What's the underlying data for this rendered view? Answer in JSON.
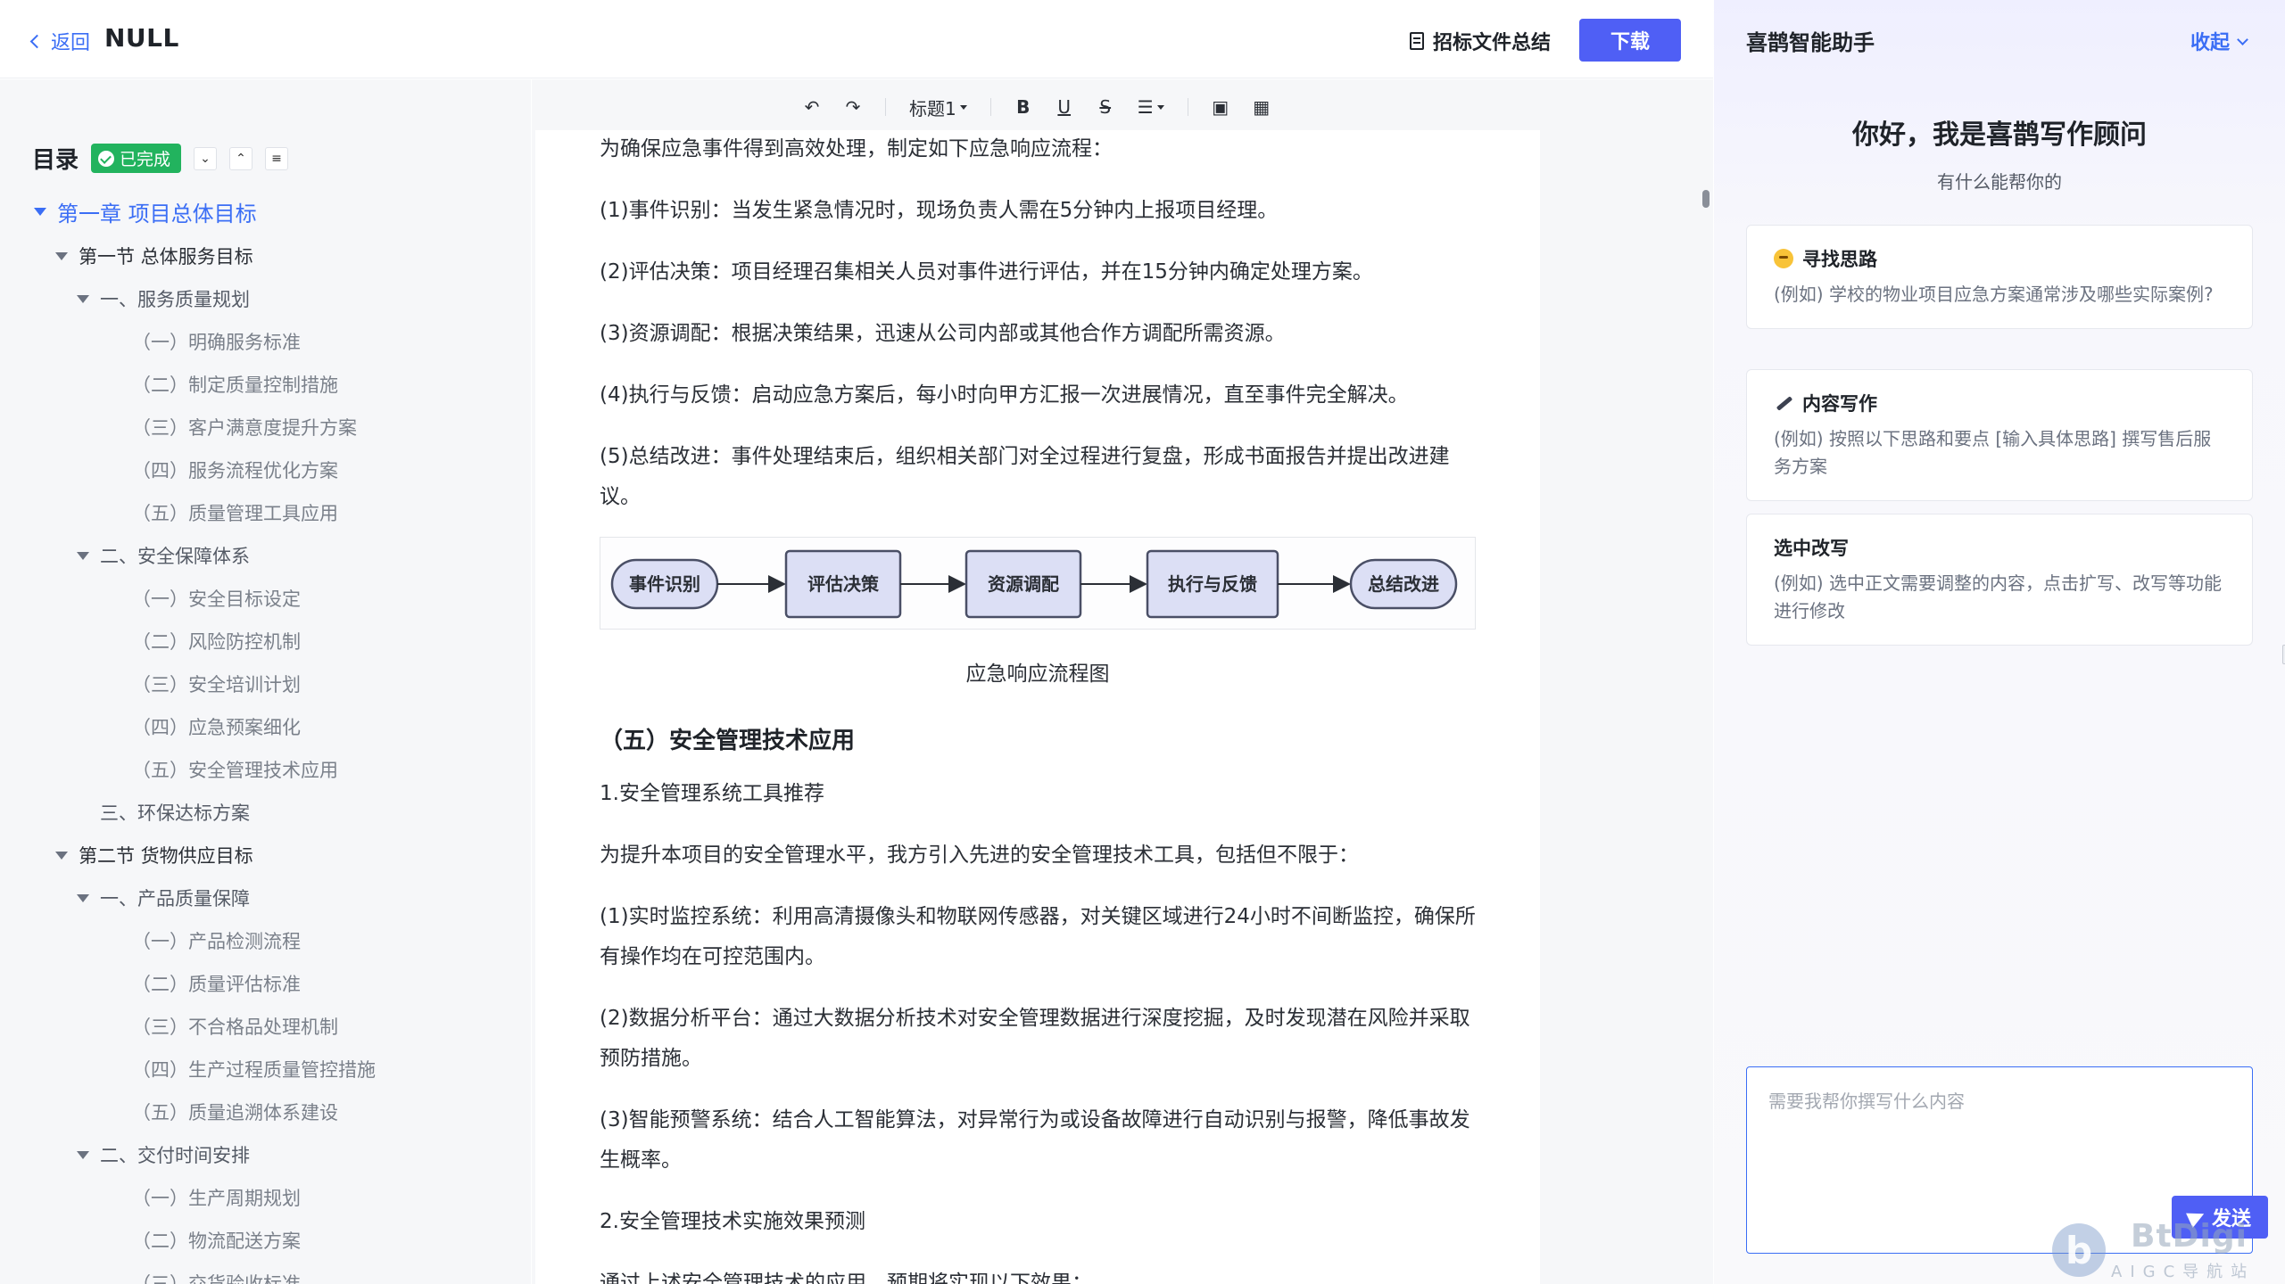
{
  "header": {
    "back_label": "返回",
    "doc_title": "NULL",
    "summary_label": "招标文件总结",
    "download_label": "下载"
  },
  "toc": {
    "title": "目录",
    "status_badge": "已完成",
    "items": [
      {
        "level": 1,
        "label": "第一章 项目总体目标",
        "expanded": true
      },
      {
        "level": 2,
        "label": "第一节 总体服务目标",
        "expanded": true
      },
      {
        "level": 3,
        "label": "一、服务质量规划",
        "expanded": true
      },
      {
        "level": 4,
        "label": "（一）明确服务标准"
      },
      {
        "level": 4,
        "label": "（二）制定质量控制措施"
      },
      {
        "level": 4,
        "label": "（三）客户满意度提升方案"
      },
      {
        "level": 4,
        "label": "（四）服务流程优化方案"
      },
      {
        "level": 4,
        "label": "（五）质量管理工具应用"
      },
      {
        "level": 3,
        "label": "二、安全保障体系",
        "expanded": true
      },
      {
        "level": 4,
        "label": "（一）安全目标设定"
      },
      {
        "level": 4,
        "label": "（二）风险防控机制"
      },
      {
        "level": 4,
        "label": "（三）安全培训计划"
      },
      {
        "level": 4,
        "label": "（四）应急预案细化"
      },
      {
        "level": 4,
        "label": "（五）安全管理技术应用"
      },
      {
        "level": 3,
        "label": "三、环保达标方案",
        "expanded": false
      },
      {
        "level": 2,
        "label": "第二节 货物供应目标",
        "expanded": true
      },
      {
        "level": 3,
        "label": "一、产品质量保障",
        "expanded": true
      },
      {
        "level": 4,
        "label": "（一）产品检测流程"
      },
      {
        "level": 4,
        "label": "（二）质量评估标准"
      },
      {
        "level": 4,
        "label": "（三）不合格品处理机制"
      },
      {
        "level": 4,
        "label": "（四）生产过程质量管控措施"
      },
      {
        "level": 4,
        "label": "（五）质量追溯体系建设"
      },
      {
        "level": 3,
        "label": "二、交付时间安排",
        "expanded": true
      },
      {
        "level": 4,
        "label": "（一）生产周期规划"
      },
      {
        "level": 4,
        "label": "（二）物流配送方案"
      },
      {
        "level": 4,
        "label": "（三）交货验收标准"
      }
    ]
  },
  "toolbar": {
    "heading_select": "标题1"
  },
  "document": {
    "intro": "为确保应急事件得到高效处理，制定如下应急响应流程：",
    "steps": [
      "(1)事件识别：当发生紧急情况时，现场负责人需在5分钟内上报项目经理。",
      "(2)评估决策：项目经理召集相关人员对事件进行评估，并在15分钟内确定处理方案。",
      "(3)资源调配：根据决策结果，迅速从公司内部或其他合作方调配所需资源。",
      "(4)执行与反馈：启动应急方案后，每小时向甲方汇报一次进展情况，直至事件完全解决。",
      "(5)总结改进：事件处理结束后，组织相关部门对全过程进行复盘，形成书面报告并提出改进建议。"
    ],
    "flow_nodes": [
      "事件识别",
      "评估决策",
      "资源调配",
      "执行与反馈",
      "总结改进"
    ],
    "flow_caption": "应急响应流程图",
    "section_heading": "（五）安全管理技术应用",
    "sub1": "1.安全管理系统工具推荐",
    "tools_intro": "为提升本项目的安全管理水平，我方引入先进的安全管理技术工具，包括但不限于：",
    "tools": [
      "(1)实时监控系统：利用高清摄像头和物联网传感器，对关键区域进行24小时不间断监控，确保所有操作均在可控范围内。",
      "(2)数据分析平台：通过大数据分析技术对安全管理数据进行深度挖掘，及时发现潜在风险并采取预防措施。",
      "(3)智能预警系统：结合人工智能算法，对异常行为或设备故障进行自动识别与报警，降低事故发生概率。"
    ],
    "sub2": "2.安全管理技术实施效果预测",
    "tail": "通过上述安全管理技术的应用，预期将实现以下效果："
  },
  "assistant": {
    "title": "喜鹊智能助手",
    "collapse_label": "收起",
    "greeting": "你好，我是喜鹊写作顾问",
    "greeting_sub": "有什么能帮你的",
    "cards": [
      {
        "icon": "thinking-face-icon",
        "title": "寻找思路",
        "desc": "(例如) 学校的物业项目应急方案通常涉及哪些实际案例?"
      },
      {
        "icon": "pen-icon",
        "title": "内容写作",
        "desc": "(例如) 按照以下思路和要点 [输入具体思路] 撰写售后服务方案"
      },
      {
        "icon": "page-icon",
        "title": "选中改写",
        "desc": "(例如) 选中正文需要调整的内容，点击扩写、改写等功能进行修改"
      }
    ],
    "input_placeholder": "需要我帮你撰写什么内容",
    "send_label": "发送"
  },
  "watermark": {
    "brand": "BtDigi",
    "tagline": "AIGC导航站"
  },
  "colors": {
    "accent": "#4f5ff5",
    "link": "#3b6ef5",
    "success": "#22b35e",
    "flow_node_fill": "#dcdff5",
    "flow_node_border": "#4a4f66"
  }
}
